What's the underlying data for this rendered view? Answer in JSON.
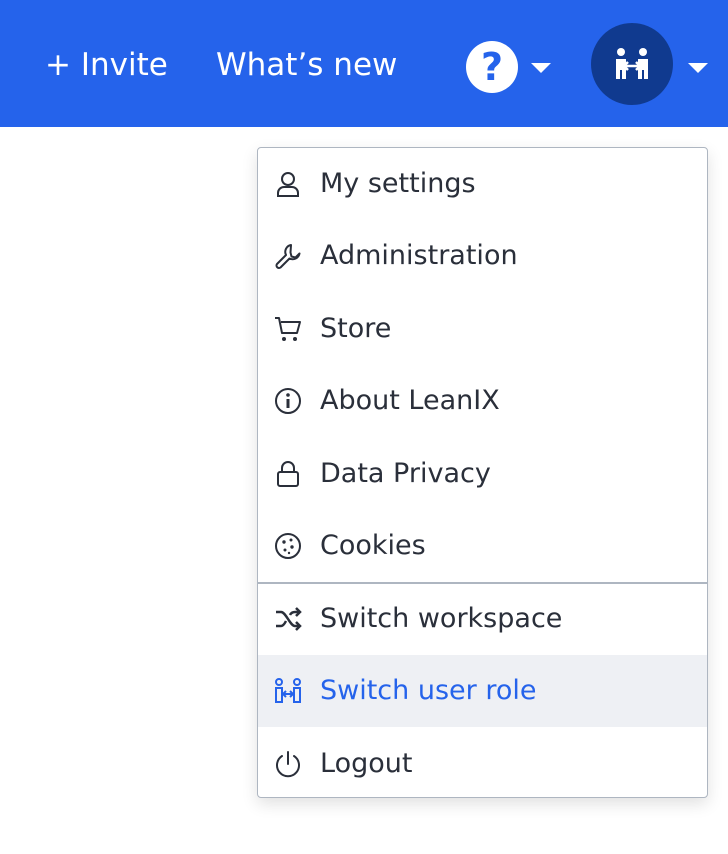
{
  "header": {
    "invite_label": "+ Invite",
    "whatsnew_label": "What’s new",
    "help_glyph": "?",
    "help_icon": "question-circle-icon",
    "avatar_icon": "switch-user-role-icon",
    "caret_icon": "chevron-down-icon"
  },
  "menu": {
    "items": [
      {
        "label": "My settings",
        "icon": "user-icon"
      },
      {
        "label": "Administration",
        "icon": "wrench-icon"
      },
      {
        "label": "Store",
        "icon": "cart-icon"
      },
      {
        "label": "About LeanIX",
        "icon": "info-icon"
      },
      {
        "label": "Data Privacy",
        "icon": "lock-icon"
      },
      {
        "label": "Cookies",
        "icon": "cookie-icon"
      },
      {
        "label": "Switch workspace",
        "icon": "shuffle-icon"
      },
      {
        "label": "Switch user role",
        "icon": "switch-user-role-icon",
        "highlighted": true
      },
      {
        "label": "Logout",
        "icon": "power-icon"
      }
    ]
  },
  "colors": {
    "brand": "#2563eb",
    "avatar_bg": "#103a8f",
    "menu_text": "#2a2f3a",
    "hover_bg": "#eef0f4",
    "border": "#aeb6c1"
  }
}
